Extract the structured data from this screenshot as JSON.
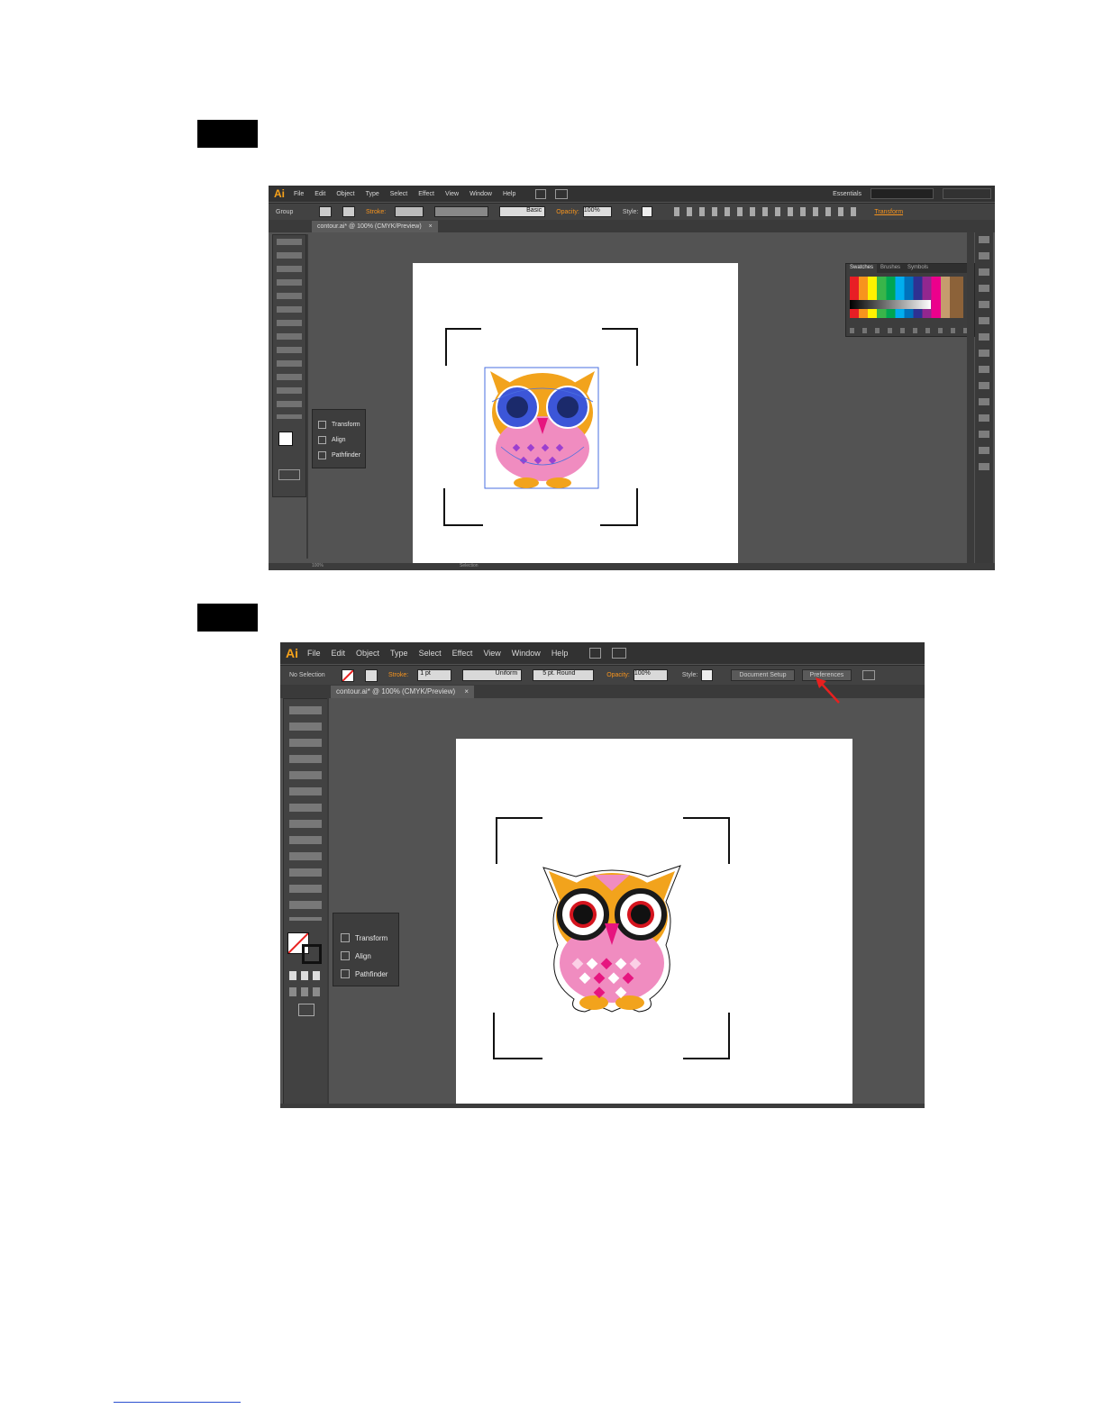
{
  "screenshot1": {
    "menu": {
      "logo": "Ai",
      "items": [
        "File",
        "Edit",
        "Object",
        "Type",
        "Select",
        "Effect",
        "View",
        "Window",
        "Help"
      ],
      "workspace": "Essentials"
    },
    "control": {
      "selection_label": "Group",
      "stroke_label": "Stroke:",
      "brush_label": "Basic",
      "opacity_label": "Opacity:",
      "opacity_value": "100%",
      "style_label": "Style:",
      "transform_label": "Transform"
    },
    "tab": {
      "title": "contour.ai* @ 100% (CMYK/Preview)",
      "close": "×"
    },
    "panel": {
      "items": [
        "Transform",
        "Align",
        "Pathfinder"
      ]
    },
    "swatches": {
      "tabs": [
        "Swatches",
        "Brushes",
        "Symbols"
      ]
    },
    "status": {
      "zoom": "100%",
      "tool": "Selection"
    }
  },
  "screenshot2": {
    "menu": {
      "logo": "Ai",
      "items": [
        "File",
        "Edit",
        "Object",
        "Type",
        "Select",
        "Effect",
        "View",
        "Window",
        "Help"
      ]
    },
    "control": {
      "selection_label": "No Selection",
      "stroke_label": "Stroke:",
      "stroke_value": "1 pt",
      "profile": "Uniform",
      "brush": "5 pt. Round",
      "opacity_label": "Opacity:",
      "opacity_value": "100%",
      "style_label": "Style:",
      "document_setup": "Document Setup",
      "preferences": "Preferences"
    },
    "tab": {
      "title": "contour.ai* @ 100% (CMYK/Preview)",
      "close": "×"
    },
    "panel": {
      "items": [
        "Transform",
        "Align",
        "Pathfinder"
      ]
    }
  },
  "colors": {
    "ui_dark": "#535353",
    "menubar": "#323232",
    "accent_orange": "#f7941d",
    "owl_orange": "#f2a31c",
    "owl_pink": "#f08cc0",
    "owl_magenta": "#e6157f",
    "selection_blue": "#4a6fe0",
    "arrow_red": "#e8201f"
  }
}
